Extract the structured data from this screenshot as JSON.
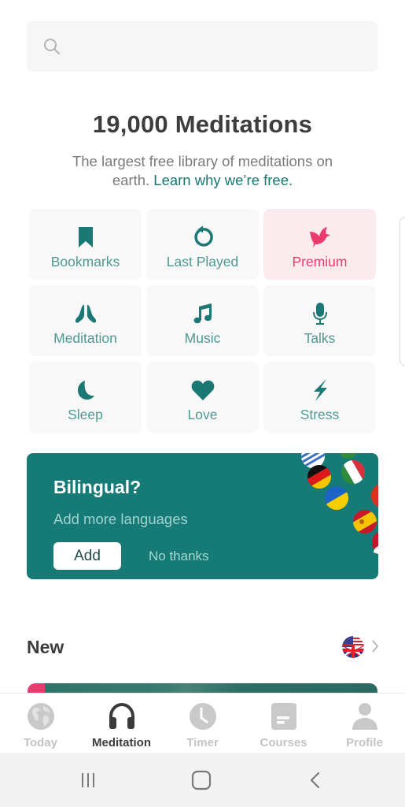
{
  "search": {
    "placeholder": "",
    "value": "",
    "icon": "search-icon"
  },
  "hero": {
    "title": "19,000 Meditations",
    "subtitle_plain": "The largest free library of meditations on earth. ",
    "subtitle_link": "Learn why we’re free."
  },
  "categories": [
    {
      "label": "Bookmarks",
      "icon": "bookmark-icon"
    },
    {
      "label": "Last Played",
      "icon": "history-icon"
    },
    {
      "label": "Premium",
      "icon": "bird-icon",
      "highlight": true
    },
    {
      "label": "Meditation",
      "icon": "praying-hands-icon"
    },
    {
      "label": "Music",
      "icon": "music-note-icon"
    },
    {
      "label": "Talks",
      "icon": "microphone-icon"
    },
    {
      "label": "Sleep",
      "icon": "moon-icon"
    },
    {
      "label": "Love",
      "icon": "heart-icon"
    },
    {
      "label": "Stress",
      "icon": "lightning-icon"
    }
  ],
  "banner": {
    "title": "Bilingual?",
    "subtitle": "Add more languages",
    "add_label": "Add",
    "dismiss_label": "No thanks",
    "flags": [
      "greece",
      "germany",
      "italy",
      "ukraine",
      "spain",
      "unknown-red",
      "unknown-red-white"
    ]
  },
  "section": {
    "title": "New",
    "language_flag": "us-uk-flag"
  },
  "tabs": [
    {
      "label": "Today",
      "icon": "globe-icon",
      "active": false
    },
    {
      "label": "Meditation",
      "icon": "headphones-icon",
      "active": true
    },
    {
      "label": "Timer",
      "icon": "clock-icon",
      "active": false
    },
    {
      "label": "Courses",
      "icon": "courses-icon",
      "active": false
    },
    {
      "label": "Profile",
      "icon": "profile-icon",
      "active": false
    }
  ],
  "system_nav": {
    "recents": "recent-apps-icon",
    "home": "home-icon",
    "back": "back-icon"
  },
  "colors": {
    "brand_teal": "#167a76",
    "teal_label": "#4f9893",
    "premium_pink": "#ec3a6e",
    "premium_bg": "#fbebef",
    "tile_bg": "#f8f8f8",
    "inactive_tab": "#c4c4c4",
    "active_tab": "#3d3d3d"
  }
}
